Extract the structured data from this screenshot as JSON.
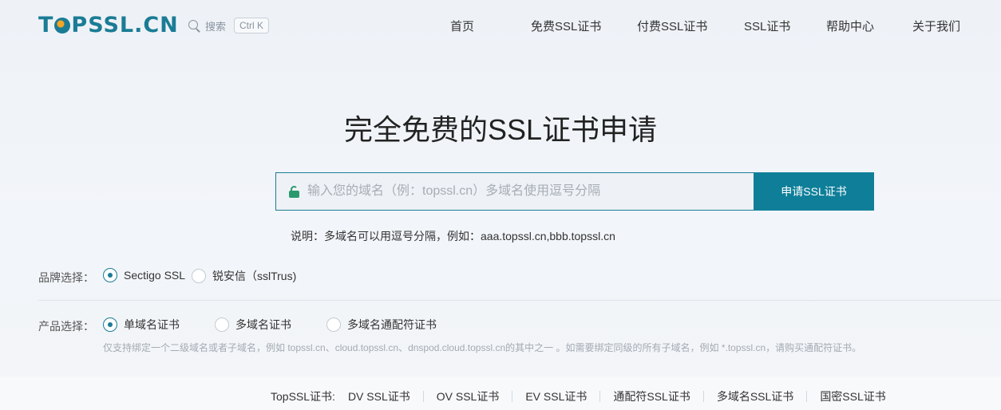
{
  "header": {
    "logo_left": "T",
    "logo_right": "PSSL.CN",
    "search": {
      "label": "搜索",
      "shortcut": "Ctrl K"
    },
    "nav": [
      "首页",
      "免费SSL证书",
      "付费SSL证书",
      "SSL证书",
      "帮助中心",
      "关于我们"
    ]
  },
  "hero": {
    "title": "完全免费的SSL证书申请",
    "input_placeholder": "输入您的域名（例：topssl.cn）多域名使用逗号分隔",
    "button": "申请SSL证书",
    "hint": "说明：多域名可以用逗号分隔，例如：aaa.topssl.cn,bbb.topssl.cn"
  },
  "brand": {
    "label": "品牌选择：",
    "options": [
      {
        "label": "Sectigo SSL",
        "checked": true
      },
      {
        "label": "锐安信（sslTrus)",
        "checked": false
      }
    ]
  },
  "product": {
    "label": "产品选择：",
    "options": [
      {
        "label": "单域名证书",
        "checked": true
      },
      {
        "label": "多域名证书",
        "checked": false
      },
      {
        "label": "多域名通配符证书",
        "checked": false
      }
    ],
    "note": "仅支持绑定一个二级域名或者子域名，例如 topssl.cn、cloud.topssl.cn、dnspod.cloud.topssl.cn的其中之一 。如需要绑定同级的所有子域名，例如 *.topssl.cn，请购买通配符证书。"
  },
  "footer": {
    "label": "TopSSL证书:",
    "links": [
      "DV SSL证书",
      "OV SSL证书",
      "EV SSL证书",
      "通配符SSL证书",
      "多域名SSL证书",
      "国密SSL证书"
    ]
  },
  "colors": {
    "brand": "#1b7c95",
    "button": "#0f7f99",
    "lock": "#2a9a6e"
  }
}
